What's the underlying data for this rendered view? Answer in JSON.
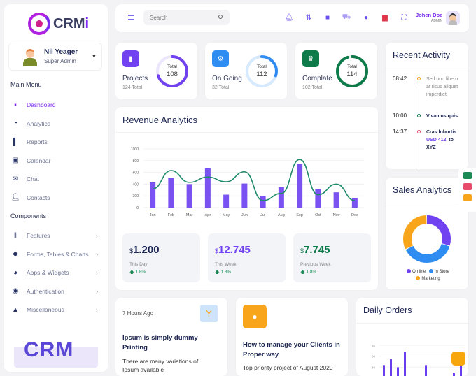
{
  "brand": {
    "name_main": "CRM",
    "name_accent": "i"
  },
  "user": {
    "name": "Nil Yeager",
    "role": "Super Admin"
  },
  "sidebar": {
    "main_menu_label": "Main Menu",
    "main_items": [
      {
        "label": "Dashboard",
        "icon": "grid-icon",
        "active": true
      },
      {
        "label": "Analytics",
        "icon": "pie-chart-icon"
      },
      {
        "label": "Reports",
        "icon": "report-icon"
      },
      {
        "label": "Calendar",
        "icon": "calendar-icon"
      },
      {
        "label": "Chat",
        "icon": "chat-icon"
      },
      {
        "label": "Contacts",
        "icon": "add-contact-icon"
      }
    ],
    "components_label": "Components",
    "component_items": [
      {
        "label": "Features",
        "icon": "books-icon"
      },
      {
        "label": "Forms, Tables & Charts",
        "icon": "cube-icon"
      },
      {
        "label": "Apps & Widgets",
        "icon": "globe-icon"
      },
      {
        "label": "Authentication",
        "icon": "lock-icon"
      },
      {
        "label": "Miscellaneous",
        "icon": "warning-icon"
      }
    ],
    "promo_text": "CRM"
  },
  "topbar": {
    "search_placeholder": "Search",
    "profile_name": "Johen Doe",
    "profile_role": "ADMIN",
    "icons": [
      "bell-icon",
      "sliders-icon",
      "file-icon",
      "cart-icon",
      "chat-dots-icon",
      "flag-icon",
      "fullscreen-icon"
    ]
  },
  "stats": [
    {
      "label": "Projects",
      "sub": "124 Total",
      "ring_label": "Total",
      "ring_value": "108",
      "ring_fraction": 0.7,
      "color": "#7042f0",
      "track": "#ece6fd"
    },
    {
      "label": "On Going",
      "sub": "32 Total",
      "ring_label": "Total",
      "ring_value": "112",
      "ring_fraction": 0.3,
      "color": "#2f8cf0",
      "track": "#d6e9fd"
    },
    {
      "label": "Complate",
      "sub": "102 Total",
      "ring_label": "Total",
      "ring_value": "114",
      "ring_fraction": 0.95,
      "color": "#0e7a4a",
      "track": "#e2f3ea"
    }
  ],
  "revenue": {
    "title": "Revenue Analytics",
    "cards": [
      {
        "currency": "$",
        "value": "1.200",
        "label": "This Day",
        "change": "1.8%",
        "color": "#1b2550"
      },
      {
        "currency": "$",
        "value": "12.745",
        "label": "This Week",
        "change": "1.8%",
        "color": "#7042f0"
      },
      {
        "currency": "$",
        "value": "7.745",
        "label": "Previous Week",
        "change": "1.8%",
        "color": "#0e7a4a"
      }
    ]
  },
  "chart_data": [
    {
      "type": "bar",
      "title": "Revenue Analytics",
      "categories": [
        "Jan",
        "Feb",
        "Mar",
        "Apr",
        "May",
        "Jun",
        "Jul",
        "Aug",
        "Sep",
        "Oct",
        "Nov",
        "Dec"
      ],
      "series": [
        {
          "name": "bars",
          "type": "bar",
          "values": [
            430,
            500,
            400,
            670,
            220,
            410,
            200,
            350,
            750,
            320,
            260,
            160
          ]
        },
        {
          "name": "line",
          "type": "line",
          "values": [
            320,
            630,
            430,
            520,
            440,
            610,
            120,
            240,
            820,
            220,
            400,
            120
          ]
        }
      ],
      "ylim": [
        0,
        1000
      ],
      "yticks": [
        0,
        200,
        400,
        600,
        800,
        1000
      ],
      "grid": true
    },
    {
      "type": "pie",
      "title": "Sales Analytics",
      "labels": [
        "On line",
        "In Store",
        "Marketing"
      ],
      "values": [
        30,
        38,
        32
      ],
      "colors": [
        "#7042f0",
        "#2f8cf0",
        "#f8a51c"
      ]
    },
    {
      "type": "bar",
      "title": "Daily Orders",
      "yticks": [
        40,
        60,
        80
      ],
      "values": [
        44,
        55,
        40,
        68,
        0,
        0,
        44,
        0,
        0,
        0,
        30,
        46
      ]
    }
  ],
  "activity": {
    "title": "Recent Activity",
    "items": [
      {
        "time": "08:42",
        "text": "Sed non libero at risus aliquet imperdiet.",
        "color": "#f8a51c"
      },
      {
        "time": "10:00",
        "text": "Vivamus quis",
        "color": "#0e7a4a"
      },
      {
        "time": "14:37",
        "text": "Cras lobortis",
        "link": "USD 412.",
        "after": " to XYZ",
        "color": "#e84a6a"
      }
    ]
  },
  "sales": {
    "title": "Sales Analytics",
    "legend": [
      "On line",
      "In Store",
      "Marketing"
    ]
  },
  "news": [
    {
      "time": "7 Hours Ago",
      "title": "Ipsum is simply dummy Printing",
      "body": "There are many variations of. Ipsum available"
    },
    {
      "title": "How to manage your Clients in Proper way",
      "body": "Top priority project of August 2020"
    }
  ],
  "orders": {
    "title": "Daily Orders"
  }
}
